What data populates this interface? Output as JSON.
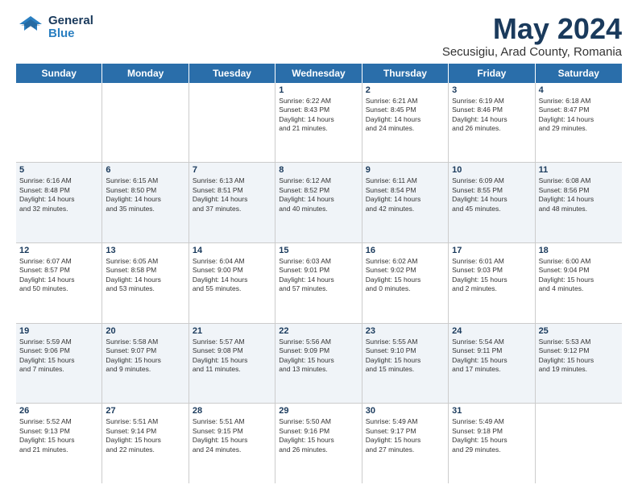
{
  "logo": {
    "general": "General",
    "blue": "Blue"
  },
  "title": "May 2024",
  "subtitle": "Secusigiu, Arad County, Romania",
  "weekdays": [
    "Sunday",
    "Monday",
    "Tuesday",
    "Wednesday",
    "Thursday",
    "Friday",
    "Saturday"
  ],
  "rows": [
    {
      "alt": false,
      "cells": [
        {
          "day": "",
          "lines": []
        },
        {
          "day": "",
          "lines": []
        },
        {
          "day": "",
          "lines": []
        },
        {
          "day": "1",
          "lines": [
            "Sunrise: 6:22 AM",
            "Sunset: 8:43 PM",
            "Daylight: 14 hours",
            "and 21 minutes."
          ]
        },
        {
          "day": "2",
          "lines": [
            "Sunrise: 6:21 AM",
            "Sunset: 8:45 PM",
            "Daylight: 14 hours",
            "and 24 minutes."
          ]
        },
        {
          "day": "3",
          "lines": [
            "Sunrise: 6:19 AM",
            "Sunset: 8:46 PM",
            "Daylight: 14 hours",
            "and 26 minutes."
          ]
        },
        {
          "day": "4",
          "lines": [
            "Sunrise: 6:18 AM",
            "Sunset: 8:47 PM",
            "Daylight: 14 hours",
            "and 29 minutes."
          ]
        }
      ]
    },
    {
      "alt": true,
      "cells": [
        {
          "day": "5",
          "lines": [
            "Sunrise: 6:16 AM",
            "Sunset: 8:48 PM",
            "Daylight: 14 hours",
            "and 32 minutes."
          ]
        },
        {
          "day": "6",
          "lines": [
            "Sunrise: 6:15 AM",
            "Sunset: 8:50 PM",
            "Daylight: 14 hours",
            "and 35 minutes."
          ]
        },
        {
          "day": "7",
          "lines": [
            "Sunrise: 6:13 AM",
            "Sunset: 8:51 PM",
            "Daylight: 14 hours",
            "and 37 minutes."
          ]
        },
        {
          "day": "8",
          "lines": [
            "Sunrise: 6:12 AM",
            "Sunset: 8:52 PM",
            "Daylight: 14 hours",
            "and 40 minutes."
          ]
        },
        {
          "day": "9",
          "lines": [
            "Sunrise: 6:11 AM",
            "Sunset: 8:54 PM",
            "Daylight: 14 hours",
            "and 42 minutes."
          ]
        },
        {
          "day": "10",
          "lines": [
            "Sunrise: 6:09 AM",
            "Sunset: 8:55 PM",
            "Daylight: 14 hours",
            "and 45 minutes."
          ]
        },
        {
          "day": "11",
          "lines": [
            "Sunrise: 6:08 AM",
            "Sunset: 8:56 PM",
            "Daylight: 14 hours",
            "and 48 minutes."
          ]
        }
      ]
    },
    {
      "alt": false,
      "cells": [
        {
          "day": "12",
          "lines": [
            "Sunrise: 6:07 AM",
            "Sunset: 8:57 PM",
            "Daylight: 14 hours",
            "and 50 minutes."
          ]
        },
        {
          "day": "13",
          "lines": [
            "Sunrise: 6:05 AM",
            "Sunset: 8:58 PM",
            "Daylight: 14 hours",
            "and 53 minutes."
          ]
        },
        {
          "day": "14",
          "lines": [
            "Sunrise: 6:04 AM",
            "Sunset: 9:00 PM",
            "Daylight: 14 hours",
            "and 55 minutes."
          ]
        },
        {
          "day": "15",
          "lines": [
            "Sunrise: 6:03 AM",
            "Sunset: 9:01 PM",
            "Daylight: 14 hours",
            "and 57 minutes."
          ]
        },
        {
          "day": "16",
          "lines": [
            "Sunrise: 6:02 AM",
            "Sunset: 9:02 PM",
            "Daylight: 15 hours",
            "and 0 minutes."
          ]
        },
        {
          "day": "17",
          "lines": [
            "Sunrise: 6:01 AM",
            "Sunset: 9:03 PM",
            "Daylight: 15 hours",
            "and 2 minutes."
          ]
        },
        {
          "day": "18",
          "lines": [
            "Sunrise: 6:00 AM",
            "Sunset: 9:04 PM",
            "Daylight: 15 hours",
            "and 4 minutes."
          ]
        }
      ]
    },
    {
      "alt": true,
      "cells": [
        {
          "day": "19",
          "lines": [
            "Sunrise: 5:59 AM",
            "Sunset: 9:06 PM",
            "Daylight: 15 hours",
            "and 7 minutes."
          ]
        },
        {
          "day": "20",
          "lines": [
            "Sunrise: 5:58 AM",
            "Sunset: 9:07 PM",
            "Daylight: 15 hours",
            "and 9 minutes."
          ]
        },
        {
          "day": "21",
          "lines": [
            "Sunrise: 5:57 AM",
            "Sunset: 9:08 PM",
            "Daylight: 15 hours",
            "and 11 minutes."
          ]
        },
        {
          "day": "22",
          "lines": [
            "Sunrise: 5:56 AM",
            "Sunset: 9:09 PM",
            "Daylight: 15 hours",
            "and 13 minutes."
          ]
        },
        {
          "day": "23",
          "lines": [
            "Sunrise: 5:55 AM",
            "Sunset: 9:10 PM",
            "Daylight: 15 hours",
            "and 15 minutes."
          ]
        },
        {
          "day": "24",
          "lines": [
            "Sunrise: 5:54 AM",
            "Sunset: 9:11 PM",
            "Daylight: 15 hours",
            "and 17 minutes."
          ]
        },
        {
          "day": "25",
          "lines": [
            "Sunrise: 5:53 AM",
            "Sunset: 9:12 PM",
            "Daylight: 15 hours",
            "and 19 minutes."
          ]
        }
      ]
    },
    {
      "alt": false,
      "cells": [
        {
          "day": "26",
          "lines": [
            "Sunrise: 5:52 AM",
            "Sunset: 9:13 PM",
            "Daylight: 15 hours",
            "and 21 minutes."
          ]
        },
        {
          "day": "27",
          "lines": [
            "Sunrise: 5:51 AM",
            "Sunset: 9:14 PM",
            "Daylight: 15 hours",
            "and 22 minutes."
          ]
        },
        {
          "day": "28",
          "lines": [
            "Sunrise: 5:51 AM",
            "Sunset: 9:15 PM",
            "Daylight: 15 hours",
            "and 24 minutes."
          ]
        },
        {
          "day": "29",
          "lines": [
            "Sunrise: 5:50 AM",
            "Sunset: 9:16 PM",
            "Daylight: 15 hours",
            "and 26 minutes."
          ]
        },
        {
          "day": "30",
          "lines": [
            "Sunrise: 5:49 AM",
            "Sunset: 9:17 PM",
            "Daylight: 15 hours",
            "and 27 minutes."
          ]
        },
        {
          "day": "31",
          "lines": [
            "Sunrise: 5:49 AM",
            "Sunset: 9:18 PM",
            "Daylight: 15 hours",
            "and 29 minutes."
          ]
        },
        {
          "day": "",
          "lines": []
        }
      ]
    }
  ]
}
